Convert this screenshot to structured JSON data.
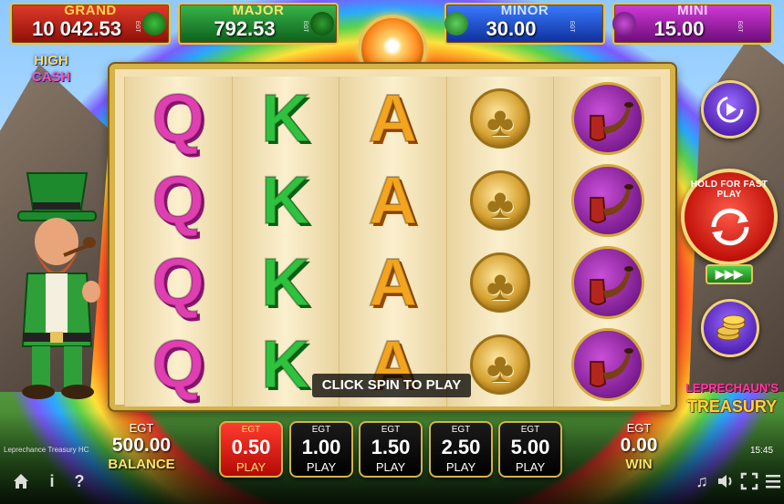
{
  "jackpots": {
    "grand": {
      "label": "GRAND",
      "value": "10 042.53",
      "currency": "EGT"
    },
    "major": {
      "label": "MAJOR",
      "value": "792.53",
      "currency": "EGT"
    },
    "minor": {
      "label": "MINOR",
      "value": "30.00",
      "currency": "EGT"
    },
    "mini": {
      "label": "MINI",
      "value": "15.00",
      "currency": "EGT"
    }
  },
  "logos": {
    "high_cash_line1": "HIGH",
    "high_cash_line2": "CASH",
    "game_line1": "LEPRECHAUN'S",
    "game_line2": "TREASURY"
  },
  "reels": [
    {
      "symbol": "Q",
      "kind": "letter",
      "color": "#e03fb2"
    },
    {
      "symbol": "K",
      "kind": "letter",
      "color": "#2fc23e"
    },
    {
      "symbol": "A",
      "kind": "letter",
      "color": "#f3a51f"
    },
    {
      "symbol": "gold-clover-coin",
      "kind": "coin"
    },
    {
      "symbol": "pipe",
      "kind": "pipe"
    }
  ],
  "status_message": "CLICK SPIN TO PLAY",
  "spin_button": {
    "label": "HOLD FOR FAST PLAY"
  },
  "turbo_label": "▶▶▶",
  "balance": {
    "currency": "EGT",
    "value": "500.00",
    "label": "BALANCE"
  },
  "win": {
    "currency": "EGT",
    "value": "0.00",
    "label": "WIN"
  },
  "bets": [
    {
      "currency": "EGT",
      "amount": "0.50",
      "label": "PLAY",
      "selected": true
    },
    {
      "currency": "EGT",
      "amount": "1.00",
      "label": "PLAY",
      "selected": false
    },
    {
      "currency": "EGT",
      "amount": "1.50",
      "label": "PLAY",
      "selected": false
    },
    {
      "currency": "EGT",
      "amount": "2.50",
      "label": "PLAY",
      "selected": false
    },
    {
      "currency": "EGT",
      "amount": "5.00",
      "label": "PLAY",
      "selected": false
    }
  ],
  "footer": {
    "game_name": "Leprechance Treasury HC",
    "clock": "15:45"
  },
  "icons": {
    "home": "home-icon",
    "info": "info-icon",
    "help": "help-icon",
    "music": "music-icon",
    "sound": "sound-icon",
    "fullscreen": "fullscreen-icon",
    "menu": "menu-icon"
  },
  "colors": {
    "gold_border": "#d6b24a",
    "selected_bet": "#ff3b2e",
    "jackpot_grand": "#e03b28",
    "jackpot_major": "#37b54a",
    "jackpot_minor": "#3a7bff",
    "jackpot_mini": "#d23bd6"
  }
}
